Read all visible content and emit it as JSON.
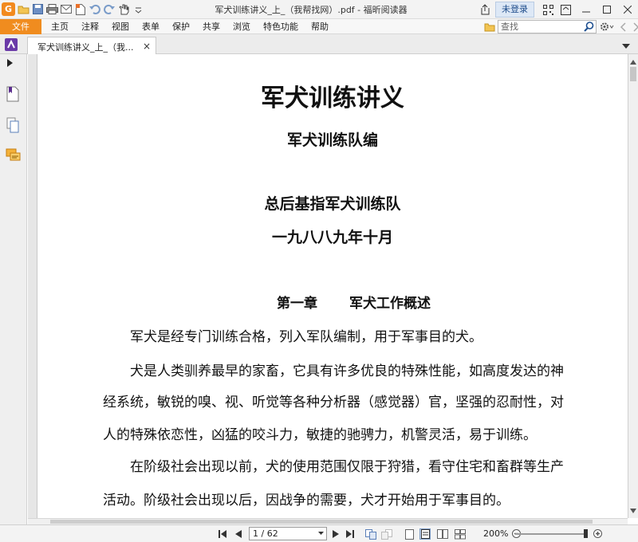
{
  "window": {
    "title": "军犬训练讲义_上_（我帮找网）.pdf - 福昕阅读器",
    "login_label": "未登录",
    "app_logo": "G"
  },
  "menu": {
    "file_label": "文件",
    "items": [
      "主页",
      "注释",
      "视图",
      "表单",
      "保护",
      "共享",
      "浏览",
      "特色功能",
      "帮助"
    ]
  },
  "search": {
    "placeholder": "查找"
  },
  "tab": {
    "label": "军犬训练讲义_上_（我...",
    "close": "×"
  },
  "document": {
    "title": "军犬训练讲义",
    "editor": "军犬训练队编",
    "organization": "总后基指军犬训练队",
    "date": "一九八八九年十月",
    "chapter_number": "第一章",
    "chapter_title": "军犬工作概述",
    "lines": [
      "　　军犬是经专门训练合格，列入军队编制，用于军事目的犬。",
      "　　犬是人类驯养最早的家畜，它具有许多优良的特殊性能，如高度发达的神",
      "经系统，敏锐的嗅、视、听觉等各种分析器（感觉器）官，坚强的忍耐性，对",
      "人的特殊依恋性，凶猛的咬斗力，敏捷的驰骋力，机警灵活，易于训练。",
      "　　在阶级社会出现以前，犬的使用范围仅限于狩猎，看守住宅和畜群等生产",
      "活动。阶级社会出现以后，因战争的需要，犬才开始用于军事目的。"
    ]
  },
  "status": {
    "page_indicator": "1 / 62",
    "zoom": "200%"
  },
  "colors": {
    "accent": "#f08c1f",
    "login_bg": "#dde8f6"
  }
}
